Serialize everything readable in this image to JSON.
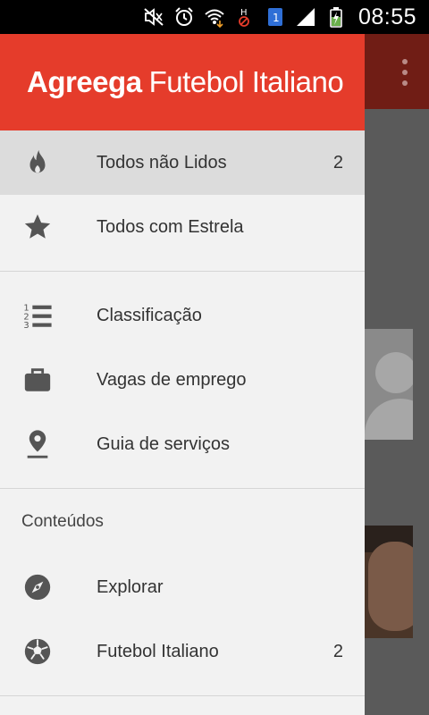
{
  "status_bar": {
    "time": "08:55",
    "icons": [
      "no-sound-icon",
      "alarm-icon",
      "wifi-icon",
      "signal-h-icon",
      "sim-1-icon",
      "cell-signal-icon",
      "battery-charging-icon"
    ]
  },
  "background_app": {
    "toolbar_color": "#701d15",
    "overflow_icon": "overflow-menu-icon"
  },
  "drawer": {
    "header": {
      "brand": "Agreega",
      "subtitle": "Futebol Italiano",
      "color": "#e53c2b"
    },
    "items": [
      {
        "icon": "flame-icon",
        "label": "Todos não Lidos",
        "count": "2",
        "selected": true
      },
      {
        "icon": "star-icon",
        "label": "Todos com Estrela",
        "count": ""
      },
      {
        "icon": "numbered-list-icon",
        "label": "Classificação",
        "count": ""
      },
      {
        "icon": "briefcase-icon",
        "label": "Vagas de emprego",
        "count": ""
      },
      {
        "icon": "location-pin-icon",
        "label": "Guia de serviços",
        "count": ""
      },
      {
        "icon": "compass-icon",
        "label": "Explorar",
        "count": ""
      },
      {
        "icon": "soccer-ball-icon",
        "label": "Futebol Italiano",
        "count": "2"
      }
    ],
    "section_title": "Conteúdos"
  }
}
